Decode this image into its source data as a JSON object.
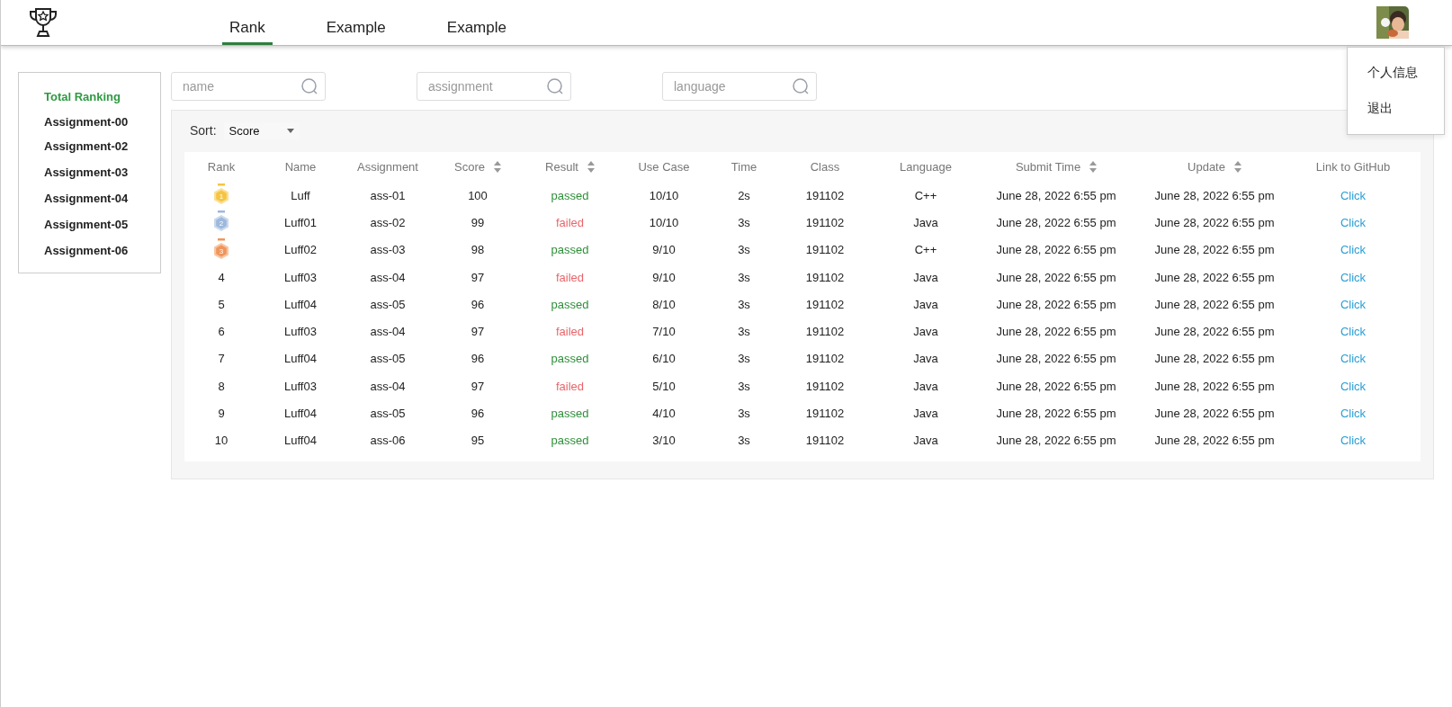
{
  "nav": {
    "tabs": [
      {
        "label": "Rank",
        "selected": true
      },
      {
        "label": "Example",
        "selected": false
      },
      {
        "label": "Example",
        "selected": false
      }
    ]
  },
  "user_menu": {
    "items": [
      "个人信息",
      "退出"
    ]
  },
  "sidebar": {
    "items": [
      {
        "label": "Total Ranking",
        "selected": true
      },
      {
        "label": "Assignment-00",
        "selected": false
      },
      {
        "label": "Assignment-02",
        "selected": false
      },
      {
        "label": "Assignment-03",
        "selected": false
      },
      {
        "label": "Assignment-04",
        "selected": false
      },
      {
        "label": "Assignment-05",
        "selected": false
      },
      {
        "label": "Assignment-06",
        "selected": false
      }
    ]
  },
  "filters": [
    {
      "placeholder": "name"
    },
    {
      "placeholder": "assignment"
    },
    {
      "placeholder": "language"
    }
  ],
  "sort": {
    "label": "Sort:",
    "value": "Score"
  },
  "table": {
    "columns": [
      {
        "label": "Rank",
        "sortable": false
      },
      {
        "label": "Name",
        "sortable": false
      },
      {
        "label": "Assignment",
        "sortable": false
      },
      {
        "label": "Score",
        "sortable": true
      },
      {
        "label": "Result",
        "sortable": true
      },
      {
        "label": "Use Case",
        "sortable": false
      },
      {
        "label": "Time",
        "sortable": false
      },
      {
        "label": "Class",
        "sortable": false
      },
      {
        "label": "Language",
        "sortable": false
      },
      {
        "label": "Submit Time",
        "sortable": true
      },
      {
        "label": "Update",
        "sortable": true
      },
      {
        "label": "Link to GitHub",
        "sortable": false
      }
    ],
    "rows": [
      {
        "rank": "1",
        "color": "#f5c542",
        "name": "Luff",
        "assignment": "ass-01",
        "score": "100",
        "result": "passed",
        "passed": true,
        "use_case": "10/10",
        "time": "2s",
        "class": "191102",
        "language": "C++",
        "submit_time": "June 28, 2022 6:55 pm",
        "update": "June 28, 2022 6:55 pm",
        "link": "Click"
      },
      {
        "rank": "2",
        "color": "#9db8dc",
        "name": "Luff01",
        "assignment": "ass-02",
        "score": "99",
        "result": "failed",
        "passed": false,
        "use_case": "10/10",
        "time": "3s",
        "class": "191102",
        "language": "Java",
        "submit_time": "June 28, 2022 6:55 pm",
        "update": "June 28, 2022 6:55 pm",
        "link": "Click"
      },
      {
        "rank": "3",
        "color": "#f0955a",
        "name": "Luff02",
        "assignment": "ass-03",
        "score": "98",
        "result": "passed",
        "passed": true,
        "use_case": "9/10",
        "time": "3s",
        "class": "191102",
        "language": "C++",
        "submit_time": "June 28, 2022 6:55 pm",
        "update": "June 28, 2022 6:55 pm",
        "link": "Click"
      },
      {
        "rank": "4",
        "name": "Luff03",
        "assignment": "ass-04",
        "score": "97",
        "result": "failed",
        "passed": false,
        "use_case": "9/10",
        "time": "3s",
        "class": "191102",
        "language": "Java",
        "submit_time": "June 28, 2022 6:55 pm",
        "update": "June 28, 2022 6:55 pm",
        "link": "Click"
      },
      {
        "rank": "5",
        "name": "Luff04",
        "assignment": "ass-05",
        "score": "96",
        "result": "passed",
        "passed": true,
        "use_case": "8/10",
        "time": "3s",
        "class": "191102",
        "language": "Java",
        "submit_time": "June 28, 2022 6:55 pm",
        "update": "June 28, 2022 6:55 pm",
        "link": "Click"
      },
      {
        "rank": "6",
        "name": "Luff03",
        "assignment": "ass-04",
        "score": "97",
        "result": "failed",
        "passed": false,
        "use_case": "7/10",
        "time": "3s",
        "class": "191102",
        "language": "Java",
        "submit_time": "June 28, 2022 6:55 pm",
        "update": "June 28, 2022 6:55 pm",
        "link": "Click"
      },
      {
        "rank": "7",
        "name": "Luff04",
        "assignment": "ass-05",
        "score": "96",
        "result": "passed",
        "passed": true,
        "use_case": "6/10",
        "time": "3s",
        "class": "191102",
        "language": "Java",
        "submit_time": "June 28, 2022 6:55 pm",
        "update": "June 28, 2022 6:55 pm",
        "link": "Click"
      },
      {
        "rank": "8",
        "name": "Luff03",
        "assignment": "ass-04",
        "score": "97",
        "result": "failed",
        "passed": false,
        "use_case": "5/10",
        "time": "3s",
        "class": "191102",
        "language": "Java",
        "submit_time": "June 28, 2022 6:55 pm",
        "update": "June 28, 2022 6:55 pm",
        "link": "Click"
      },
      {
        "rank": "9",
        "name": "Luff04",
        "assignment": "ass-05",
        "score": "96",
        "result": "passed",
        "passed": true,
        "use_case": "4/10",
        "time": "3s",
        "class": "191102",
        "language": "Java",
        "submit_time": "June 28, 2022 6:55 pm",
        "update": "June 28, 2022 6:55 pm",
        "link": "Click"
      },
      {
        "rank": "10",
        "name": "Luff04",
        "assignment": "ass-06",
        "score": "95",
        "result": "passed",
        "passed": true,
        "use_case": "3/10",
        "time": "3s",
        "class": "191102",
        "language": "Java",
        "submit_time": "June 28, 2022 6:55 pm",
        "update": "June 28, 2022 6:55 pm",
        "link": "Click"
      }
    ]
  }
}
